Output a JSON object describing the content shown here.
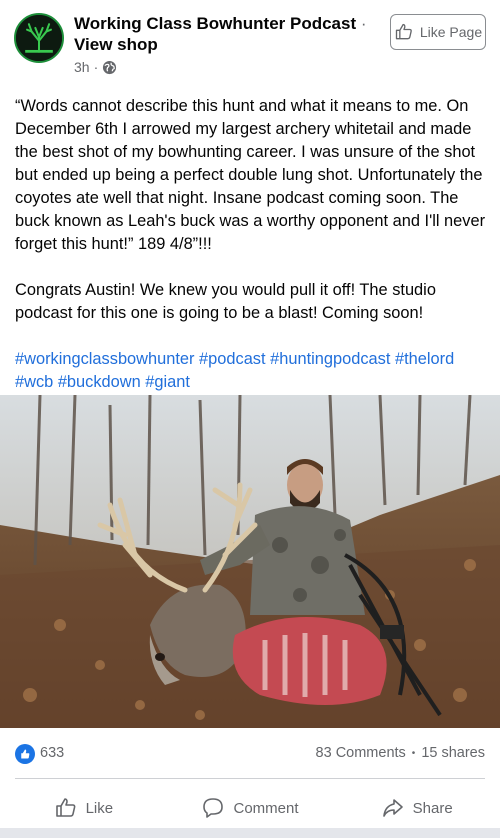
{
  "post": {
    "page_name": "Working Class Bowhunter Podcast",
    "name_separator": "·",
    "view_shop": "View shop",
    "time": "3h",
    "time_dot": "·",
    "privacy_icon": "globe-icon",
    "like_page_label": "Like Page",
    "paragraphs": [
      "“Words cannot describe this hunt and what it means to me. On December 6th I arrowed my largest archery whitetail and made the best shot of my bowhunting career.  I was unsure of the shot but ended up being a perfect double lung shot.  Unfortunately the coyotes ate well that night.  Insane podcast coming soon.  The buck known as Leah's buck was a worthy opponent and I'll never forget this hunt!”  189 4/8”!!!",
      "Congrats Austin! We knew you would pull it off! The studio podcast for this one is going to be a blast! Coming soon!"
    ],
    "hashtags": "#workingclassbowhunter #podcast #huntingpodcast #thelord #wcb #buckdown #giant"
  },
  "stats": {
    "like_count": "633",
    "comments": "83 Comments",
    "separator": "•",
    "shares": "15 shares"
  },
  "actions": {
    "like_label": "Like",
    "comment_label": "Comment",
    "share_label": "Share"
  },
  "colors": {
    "link": "#216fdb",
    "secondary_text": "#65676b",
    "like_blue": "#1b74e4"
  }
}
